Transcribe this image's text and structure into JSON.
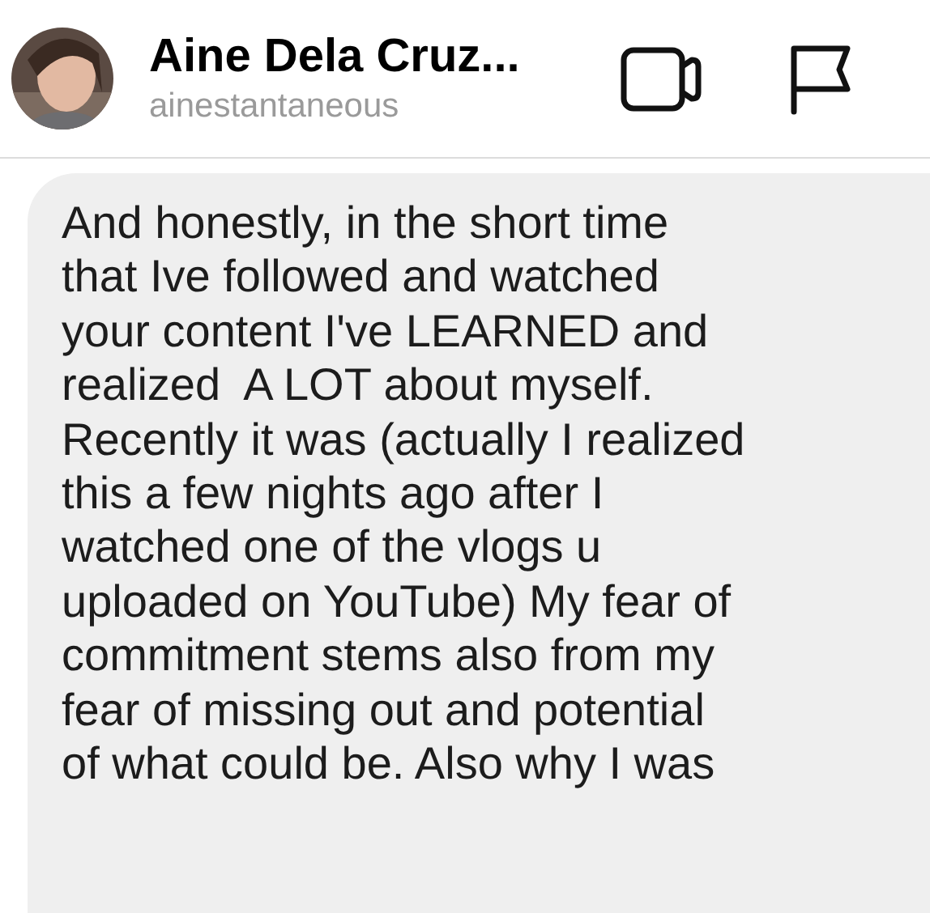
{
  "header": {
    "name": "Aine Dela Cruz...",
    "username": "ainestantaneous"
  },
  "message": {
    "lines": [
      "And honestly, in the short time",
      "that Ive followed and watched",
      "your content I've LEARNED and",
      "realized  A LOT about myself.",
      "Recently it was (actually I realized",
      "this a few nights ago after I",
      "watched one of the vlogs u",
      "uploaded on YouTube) My fear of",
      "commitment stems also from my",
      "fear of missing out and potential",
      "of what could be. Also why I was"
    ]
  }
}
